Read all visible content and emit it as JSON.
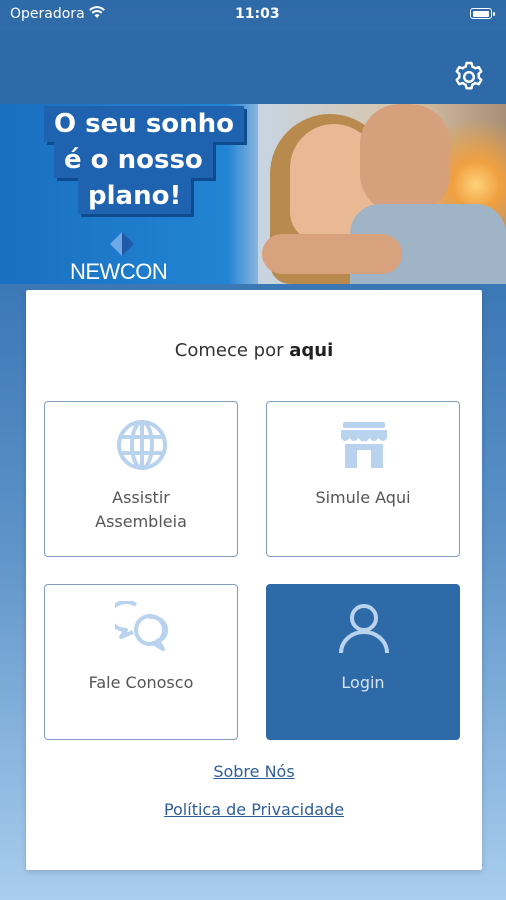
{
  "status_bar": {
    "carrier": "Operadora",
    "time": "11:03",
    "battery_level": 0.9
  },
  "header": {
    "settings_icon": "gear-icon"
  },
  "banner": {
    "slogan_lines": [
      "O seu sonho",
      "é o nosso",
      "plano!"
    ],
    "brand": "NEWCON"
  },
  "card": {
    "title_prefix": "Comece por ",
    "title_emphasis": "aqui",
    "tiles": [
      {
        "label_line1": "Assistir",
        "label_line2": "Assembleia",
        "icon": "globe-icon"
      },
      {
        "label": "Simule Aqui",
        "icon": "storefront-icon"
      },
      {
        "label": "Fale Conosco",
        "icon": "chat-bubbles-icon"
      },
      {
        "label": "Login",
        "icon": "user-icon"
      }
    ],
    "links": [
      "Sobre Nós",
      "Política de Privacidade"
    ]
  },
  "colors": {
    "primary": "#2f6aa8",
    "icon_light": "#b9d3ef",
    "tile_border": "#7f9ebf"
  }
}
